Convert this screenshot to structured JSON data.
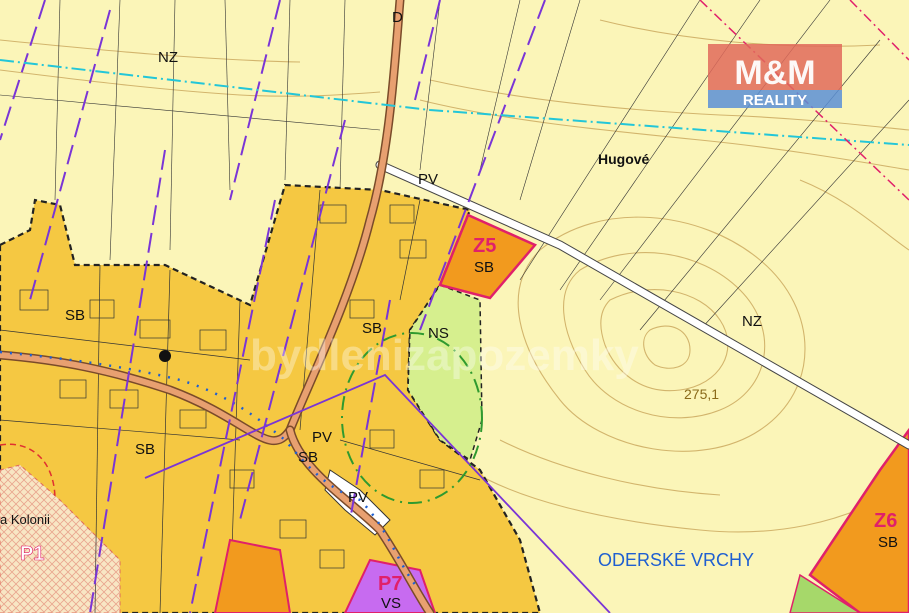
{
  "map": {
    "zone_labels": {
      "nz_top": "NZ",
      "nz_right": "NZ",
      "sb_left": "SB",
      "sb_mid": "SB",
      "sb_lower": "SB",
      "sb_center": "SB",
      "sb_z5": "SB",
      "sb_z6": "SB",
      "ns": "NS",
      "pv_top": "PV",
      "pv_mid": "PV",
      "pv_bottom": "PV",
      "vs": "VS",
      "d": "D"
    },
    "area_codes": {
      "z5": "Z5",
      "z6": "Z6",
      "p7": "P7",
      "p1": "P1"
    },
    "place_names": {
      "hugove": "Hugové",
      "kolonie": "a Kolonii",
      "oderske_vrchy": "ODERSKÉ VRCHY"
    },
    "elevation": "275,1",
    "watermark": "bydlenizapozemky",
    "logo": {
      "top": "M&M",
      "bottom": "REALITY"
    },
    "colors": {
      "background": "#fbf5b8",
      "built_zone": "#f5c842",
      "development": "#f29a1e",
      "area_code": "#e0206a",
      "ns_green": "#d6ef8e",
      "purple_line": "#7a35d6",
      "blue_name": "#1f5fd1",
      "cyan_line": "#23c6d8",
      "contour": "#c9a55a",
      "logo_red": "#e06a5a"
    }
  }
}
